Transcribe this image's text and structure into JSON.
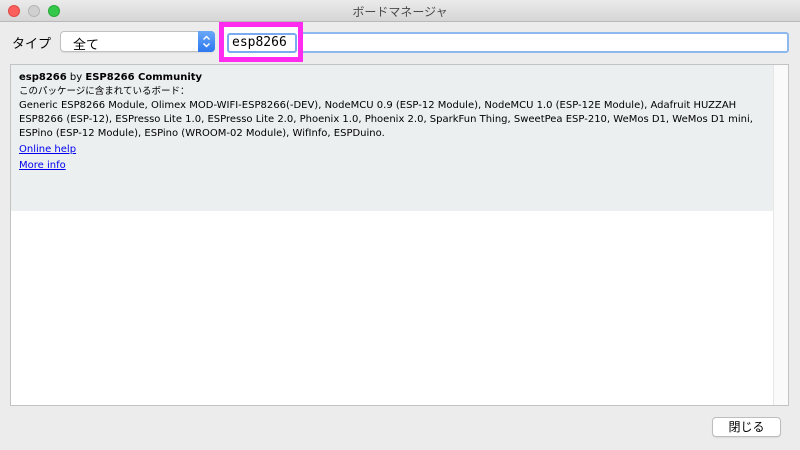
{
  "window": {
    "title": "ボードマネージャ"
  },
  "filter": {
    "type_label": "タイプ",
    "type_value": "全て",
    "search_value": "esp8266"
  },
  "package": {
    "name": "esp8266",
    "by": "by",
    "author": "ESP8266 Community",
    "boards_header": "このパッケージに含まれているボード：",
    "boards": "Generic ESP8266 Module, Olimex MOD-WIFI-ESP8266(-DEV), NodeMCU 0.9 (ESP-12 Module), NodeMCU 1.0 (ESP-12E Module), Adafruit HUZZAH ESP8266 (ESP-12), ESPresso Lite 1.0, ESPresso Lite 2.0, Phoenix 1.0, Phoenix 2.0, SparkFun Thing, SweetPea ESP-210, WeMos D1, WeMos D1 mini, ESPino (ESP-12 Module), ESPino (WROOM-02 Module), WifInfo, ESPDuino.",
    "online_help": "Online help",
    "more_info": "More info"
  },
  "footer": {
    "close_label": "閉じる"
  },
  "colors": {
    "highlight": "#ff2cf0",
    "entry_bg": "#ebefef",
    "link": "#0000ee"
  }
}
